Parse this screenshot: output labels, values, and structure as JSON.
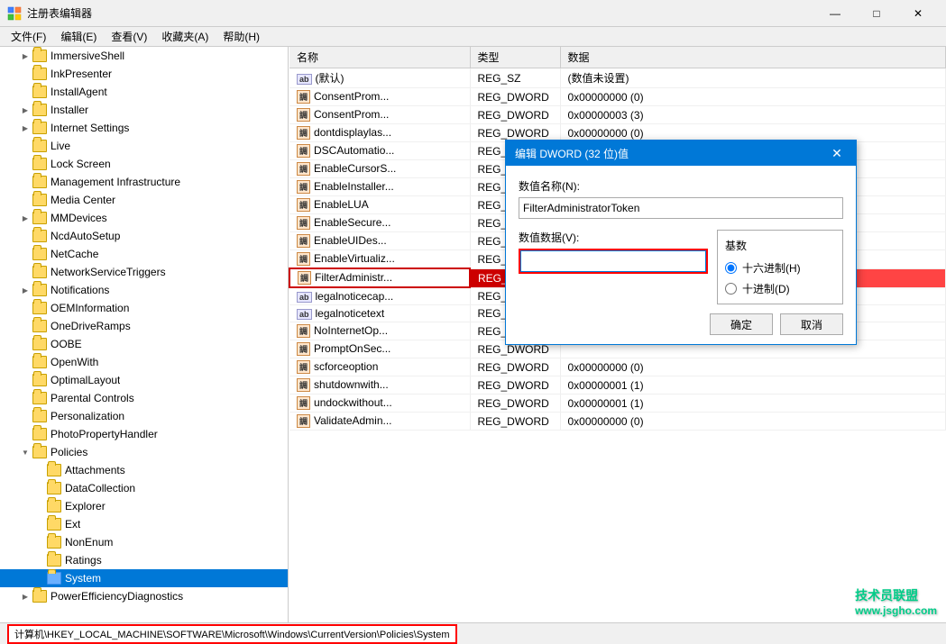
{
  "window": {
    "title": "注册表编辑器",
    "controls": {
      "minimize": "—",
      "maximize": "□",
      "close": "✕"
    }
  },
  "menubar": {
    "items": [
      "文件(F)",
      "编辑(E)",
      "查看(V)",
      "收藏夹(A)",
      "帮助(H)"
    ]
  },
  "tree": {
    "items": [
      {
        "label": "ImmersiveShell",
        "level": 1,
        "arrow": "collapsed",
        "selected": false
      },
      {
        "label": "InkPresenter",
        "level": 1,
        "arrow": "empty",
        "selected": false
      },
      {
        "label": "InstallAgent",
        "level": 1,
        "arrow": "empty",
        "selected": false
      },
      {
        "label": "Installer",
        "level": 1,
        "arrow": "collapsed",
        "selected": false
      },
      {
        "label": "Internet Settings",
        "level": 1,
        "arrow": "collapsed",
        "selected": false
      },
      {
        "label": "Live",
        "level": 1,
        "arrow": "empty",
        "selected": false
      },
      {
        "label": "Lock Screen",
        "level": 1,
        "arrow": "empty",
        "selected": false
      },
      {
        "label": "Management Infrastructure",
        "level": 1,
        "arrow": "empty",
        "selected": false
      },
      {
        "label": "Media Center",
        "level": 1,
        "arrow": "empty",
        "selected": false
      },
      {
        "label": "MMDevices",
        "level": 1,
        "arrow": "collapsed",
        "selected": false
      },
      {
        "label": "NcdAutoSetup",
        "level": 1,
        "arrow": "empty",
        "selected": false
      },
      {
        "label": "NetCache",
        "level": 1,
        "arrow": "empty",
        "selected": false
      },
      {
        "label": "NetworkServiceTriggers",
        "level": 1,
        "arrow": "empty",
        "selected": false
      },
      {
        "label": "Notifications",
        "level": 1,
        "arrow": "collapsed",
        "selected": false
      },
      {
        "label": "OEMInformation",
        "level": 1,
        "arrow": "empty",
        "selected": false
      },
      {
        "label": "OneDriveRamps",
        "level": 1,
        "arrow": "empty",
        "selected": false
      },
      {
        "label": "OOBE",
        "level": 1,
        "arrow": "empty",
        "selected": false
      },
      {
        "label": "OpenWith",
        "level": 1,
        "arrow": "empty",
        "selected": false
      },
      {
        "label": "OptimalLayout",
        "level": 1,
        "arrow": "empty",
        "selected": false
      },
      {
        "label": "Parental Controls",
        "level": 1,
        "arrow": "empty",
        "selected": false
      },
      {
        "label": "Personalization",
        "level": 1,
        "arrow": "empty",
        "selected": false
      },
      {
        "label": "PhotoPropertyHandler",
        "level": 1,
        "arrow": "empty",
        "selected": false
      },
      {
        "label": "Policies",
        "level": 1,
        "arrow": "expanded",
        "selected": false
      },
      {
        "label": "Attachments",
        "level": 2,
        "arrow": "empty",
        "selected": false
      },
      {
        "label": "DataCollection",
        "level": 2,
        "arrow": "empty",
        "selected": false
      },
      {
        "label": "Explorer",
        "level": 2,
        "arrow": "empty",
        "selected": false
      },
      {
        "label": "Ext",
        "level": 2,
        "arrow": "empty",
        "selected": false
      },
      {
        "label": "NonEnum",
        "level": 2,
        "arrow": "empty",
        "selected": false
      },
      {
        "label": "Ratings",
        "level": 2,
        "arrow": "empty",
        "selected": false
      },
      {
        "label": "System",
        "level": 2,
        "arrow": "empty",
        "selected": true
      },
      {
        "label": "PowerEfficiencyDiagnostics",
        "level": 1,
        "arrow": "collapsed",
        "selected": false
      }
    ]
  },
  "table": {
    "headers": [
      "名称",
      "类型",
      "数据"
    ],
    "rows": [
      {
        "name": "(默认)",
        "type": "REG_SZ",
        "data": "(数值未设置)",
        "icon": "ab",
        "highlighted": false
      },
      {
        "name": "ConsentProm...",
        "type": "REG_DWORD",
        "data": "0x00000000 (0)",
        "icon": "dword",
        "highlighted": false
      },
      {
        "name": "ConsentProm...",
        "type": "REG_DWORD",
        "data": "0x00000003 (3)",
        "icon": "dword",
        "highlighted": false
      },
      {
        "name": "dontdisplaylas...",
        "type": "REG_DWORD",
        "data": "0x00000000 (0)",
        "icon": "dword",
        "highlighted": false
      },
      {
        "name": "DSCAutomatio...",
        "type": "REG_DWORD",
        "data": "",
        "icon": "dword",
        "highlighted": false
      },
      {
        "name": "EnableCursorS...",
        "type": "REG_DWORD",
        "data": "",
        "icon": "dword",
        "highlighted": false
      },
      {
        "name": "EnableInstaller...",
        "type": "REG_DWORD",
        "data": "",
        "icon": "dword",
        "highlighted": false
      },
      {
        "name": "EnableLUA",
        "type": "REG_DWORD",
        "data": "",
        "icon": "dword",
        "highlighted": false
      },
      {
        "name": "EnableSecure...",
        "type": "REG_DWORD",
        "data": "",
        "icon": "dword",
        "highlighted": false
      },
      {
        "name": "EnableUIDes...",
        "type": "REG_DWORD",
        "data": "",
        "icon": "dword",
        "highlighted": false
      },
      {
        "name": "EnableVirtualiz...",
        "type": "REG_DWORD",
        "data": "",
        "icon": "dword",
        "highlighted": false
      },
      {
        "name": "FilterAdministr...",
        "type": "REG_DWORD",
        "data": "",
        "icon": "dword",
        "highlighted": true
      },
      {
        "name": "legalnoticecap...",
        "type": "REG_SZ",
        "data": "",
        "icon": "ab",
        "highlighted": false
      },
      {
        "name": "legalnoticetext",
        "type": "REG_SZ",
        "data": "",
        "icon": "ab",
        "highlighted": false
      },
      {
        "name": "NoInternetOp...",
        "type": "REG_DWORD",
        "data": "",
        "icon": "dword",
        "highlighted": false
      },
      {
        "name": "PromptOnSec...",
        "type": "REG_DWORD",
        "data": "",
        "icon": "dword",
        "highlighted": false
      },
      {
        "name": "scforceoption",
        "type": "REG_DWORD",
        "data": "0x00000000 (0)",
        "icon": "dword",
        "highlighted": false
      },
      {
        "name": "shutdownwith...",
        "type": "REG_DWORD",
        "data": "0x00000001 (1)",
        "icon": "dword",
        "highlighted": false
      },
      {
        "name": "undockwithout...",
        "type": "REG_DWORD",
        "data": "0x00000001 (1)",
        "icon": "dword",
        "highlighted": false
      },
      {
        "name": "ValidateAdmin...",
        "type": "REG_DWORD",
        "data": "0x00000000 (0)",
        "icon": "dword",
        "highlighted": false
      }
    ]
  },
  "dialog": {
    "title": "编辑 DWORD (32 位)值",
    "label_name": "数值名称(N):",
    "name_value": "FilterAdministratorToken",
    "label_data": "数值数据(V):",
    "data_value": "",
    "base_label": "基数",
    "radio_hex": "十六进制(H)",
    "radio_dec": "十进制(D)",
    "btn_ok": "确定",
    "btn_cancel": "取消"
  },
  "statusbar": {
    "path": "计算机\\HKEY_LOCAL_MACHINE\\SOFTWARE\\Microsoft\\Windows\\CurrentVersion\\Policies\\System"
  },
  "watermark": {
    "line1": "技术员联盟",
    "line2": "www.jsgho.com"
  }
}
